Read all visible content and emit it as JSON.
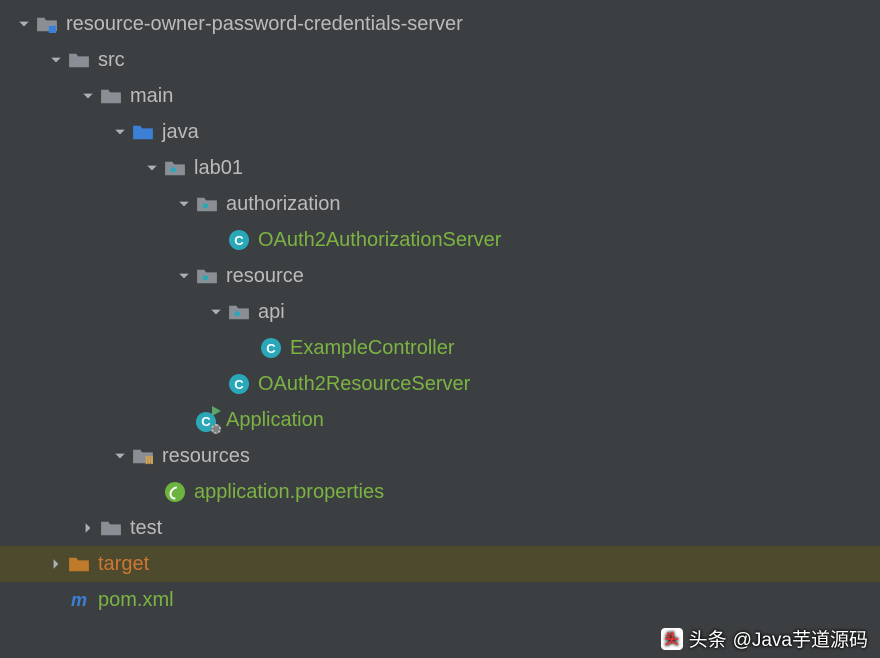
{
  "tree": {
    "root": {
      "label": "resource-owner-password-credentials-server"
    },
    "src": {
      "label": "src"
    },
    "main": {
      "label": "main"
    },
    "java": {
      "label": "java"
    },
    "lab01": {
      "label": "lab01"
    },
    "authorization": {
      "label": "authorization"
    },
    "oauthAuthServer": {
      "label": "OAuth2AuthorizationServer"
    },
    "resource": {
      "label": "resource"
    },
    "api": {
      "label": "api"
    },
    "exampleController": {
      "label": "ExampleController"
    },
    "oauthResourceServer": {
      "label": "OAuth2ResourceServer"
    },
    "application": {
      "label": "Application"
    },
    "resources": {
      "label": "resources"
    },
    "appProps": {
      "label": "application.properties"
    },
    "test": {
      "label": "test"
    },
    "target": {
      "label": "target"
    },
    "pom": {
      "label": "pom.xml"
    }
  },
  "watermark": {
    "prefix": "头条",
    "text": "@Java芋道源码"
  },
  "colors": {
    "folder_gray": "#8a8f95",
    "folder_blue": "#3b7fd6",
    "folder_orange": "#c07a2b",
    "class_circle": "#2aa7b8",
    "green_text": "#7cb342"
  }
}
